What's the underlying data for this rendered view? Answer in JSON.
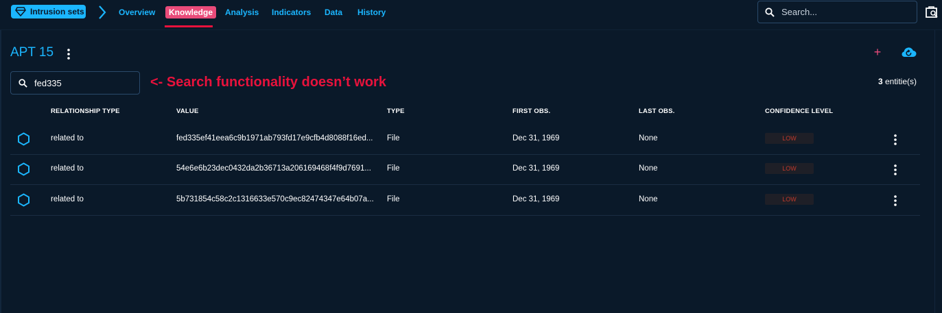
{
  "header": {
    "entity_chip": "Intrusion sets",
    "tabs": [
      {
        "label": "Overview"
      },
      {
        "label": "Knowledge"
      },
      {
        "label": "Analysis"
      },
      {
        "label": "Indicators"
      },
      {
        "label": "Data"
      },
      {
        "label": "History"
      }
    ],
    "active_tab": "Knowledge",
    "search_placeholder": "Search..."
  },
  "page": {
    "title": "APT 15",
    "search_value": "fed335",
    "annotation": "<- Search functionality doesn’t work",
    "count_number": "3",
    "count_label": " entitie(s)"
  },
  "table": {
    "columns": [
      "RELATIONSHIP TYPE",
      "VALUE",
      "TYPE",
      "FIRST OBS.",
      "LAST OBS.",
      "CONFIDENCE LEVEL"
    ],
    "rows": [
      {
        "relationship": "related to",
        "value": "fed335ef41eea6c9b1971ab793fd17e9cfb4d8088f16ed...",
        "type": "File",
        "first_obs": "Dec 31, 1969",
        "last_obs": "None",
        "confidence": "LOW"
      },
      {
        "relationship": "related to",
        "value": "54e6e6b23dec0432da2b36713a206169468f4f9d7691...",
        "type": "File",
        "first_obs": "Dec 31, 1969",
        "last_obs": "None",
        "confidence": "LOW"
      },
      {
        "relationship": "related to",
        "value": "5b731854c58c2c1316633e570c9ec82474347e64b07a...",
        "type": "File",
        "first_obs": "Dec 31, 1969",
        "last_obs": "None",
        "confidence": "LOW"
      }
    ]
  },
  "icons": {
    "chip_icon": "diamond-icon",
    "breadcrumb": "chevron-right-icon",
    "search": "search-icon",
    "top_right": "investigation-icon",
    "title_menu": "more-vert-icon",
    "add": "plus-icon",
    "cloud": "cloud-refresh-icon",
    "row_entity": "hexagon-icon",
    "row_menu": "more-vert-icon"
  },
  "colors": {
    "background": "#0a1929",
    "accent": "#1bb6ff",
    "active_tab": "#e94b7a",
    "annotation": "#e8123c",
    "confidence_low": "#c0392b"
  }
}
